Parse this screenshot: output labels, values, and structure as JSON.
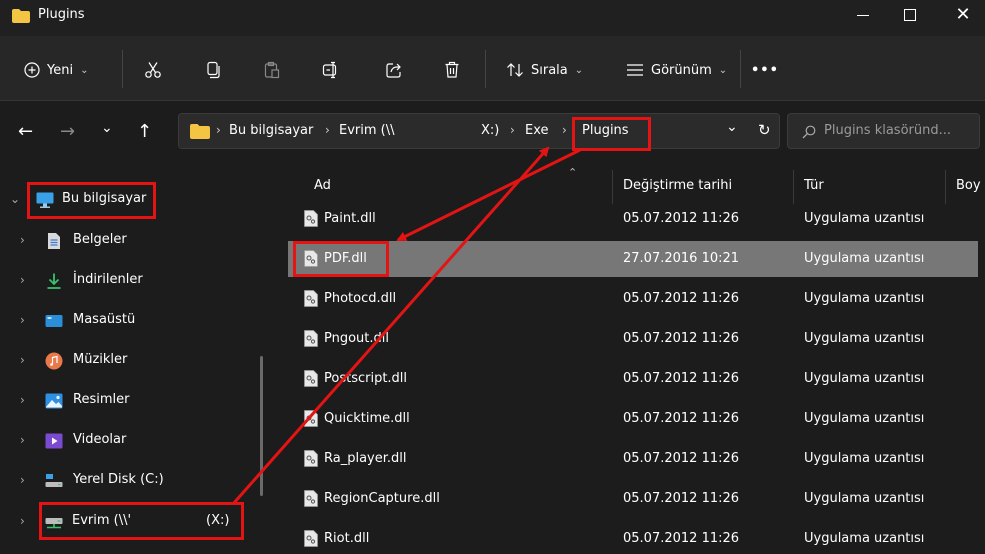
{
  "window": {
    "title": "Plugins",
    "minimize_label": "",
    "close_label": "✕"
  },
  "commandbar": {
    "new_label": "Yeni",
    "sort_label": "Sırala",
    "view_label": "Görünüm",
    "more_label": "•••"
  },
  "navigation": {
    "back": "←",
    "forward": "→",
    "recent": "⌄",
    "up": "↑",
    "refresh": "↻"
  },
  "address": {
    "crumbs": [
      "Bu bilgisayar",
      "Evrim (\\\\",
      "X:)",
      "Exe",
      "Plugins"
    ],
    "separator": "›",
    "dropdown": "⌄"
  },
  "search": {
    "placeholder": "Plugins klasöründ..."
  },
  "sidebar": {
    "items": [
      {
        "label": "Bu bilgisayar",
        "icon": "computer-icon",
        "expanded": true
      },
      {
        "label": "Belgeler",
        "icon": "documents-icon"
      },
      {
        "label": "İndirilenler",
        "icon": "downloads-icon"
      },
      {
        "label": "Masaüstü",
        "icon": "desktop-icon"
      },
      {
        "label": "Müzikler",
        "icon": "music-icon"
      },
      {
        "label": "Resimler",
        "icon": "pictures-icon"
      },
      {
        "label": "Videolar",
        "icon": "videos-icon"
      },
      {
        "label": "Yerel Disk (C:)",
        "icon": "local-disk-icon"
      },
      {
        "label": "Evrim (\\\\'",
        "label_suffix": "(X:)",
        "icon": "network-drive-icon"
      }
    ],
    "chevron_collapsed": "›",
    "chevron_expanded": "⌄"
  },
  "columns": {
    "name": "Ad",
    "date": "Değiştirme tarihi",
    "type": "Tür",
    "size": "Boy"
  },
  "files": [
    {
      "name": "Paint.dll",
      "date": "05.07.2012 11:26",
      "type": "Uygulama uzantısı"
    },
    {
      "name": "PDF.dll",
      "date": "27.07.2016 10:21",
      "type": "Uygulama uzantısı",
      "selected": true
    },
    {
      "name": "Photocd.dll",
      "date": "05.07.2012 11:26",
      "type": "Uygulama uzantısı"
    },
    {
      "name": "Pngout.dll",
      "date": "05.07.2012 11:26",
      "type": "Uygulama uzantısı"
    },
    {
      "name": "Postscript.dll",
      "date": "05.07.2012 11:26",
      "type": "Uygulama uzantısı"
    },
    {
      "name": "Quicktime.dll",
      "date": "05.07.2012 11:26",
      "type": "Uygulama uzantısı"
    },
    {
      "name": "Ra_player.dll",
      "date": "05.07.2012 11:26",
      "type": "Uygulama uzantısı"
    },
    {
      "name": "RegionCapture.dll",
      "date": "05.07.2012 11:26",
      "type": "Uygulama uzantısı"
    },
    {
      "name": "Riot.dll",
      "date": "05.07.2012 11:26",
      "type": "Uygulama uzantısı"
    }
  ],
  "colors": {
    "annotation": "#e41414",
    "folder": "#f4c542",
    "selected_row": "#777777"
  }
}
